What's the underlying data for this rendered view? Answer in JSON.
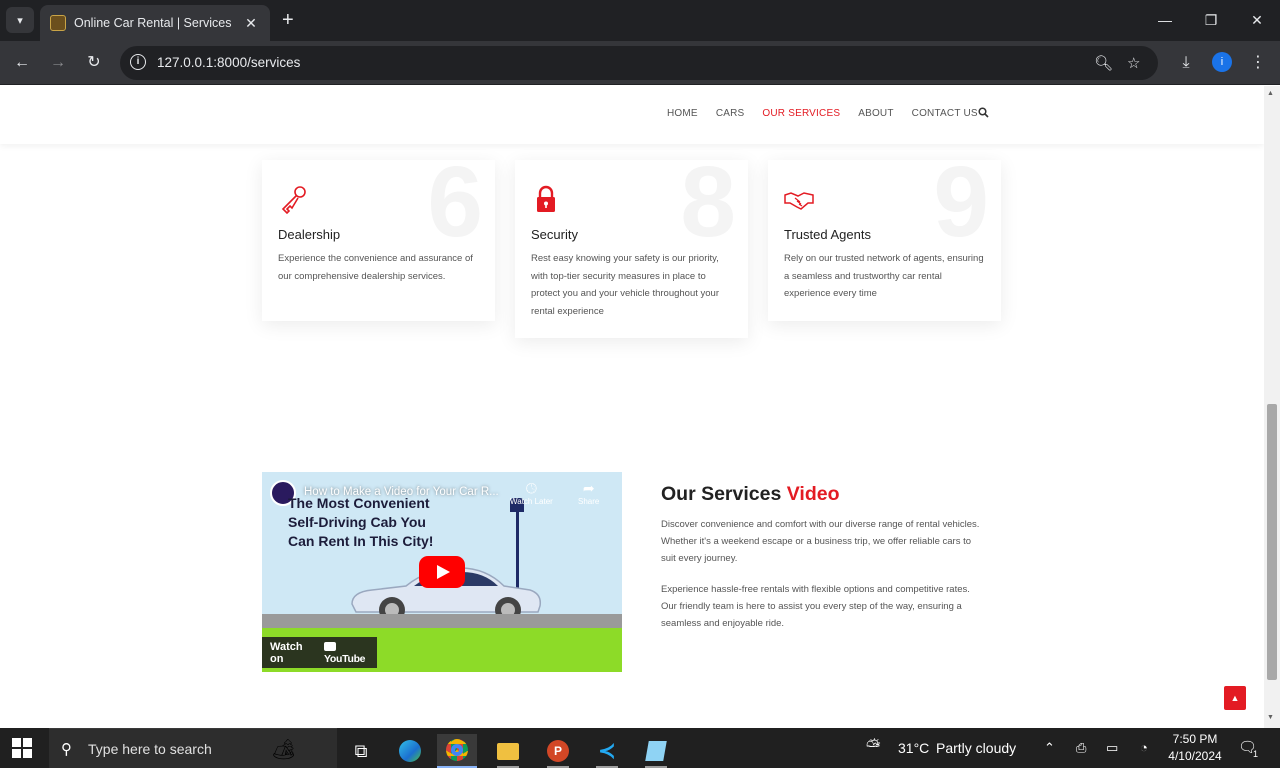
{
  "browser": {
    "tab_title": "Online Car Rental | Services",
    "url": "127.0.0.1:8000/services",
    "profile_initial": "i"
  },
  "site": {
    "nav": [
      "HOME",
      "CARS",
      "OUR SERVICES",
      "ABOUT",
      "CONTACT US"
    ],
    "active_nav": "OUR SERVICES"
  },
  "services": [
    {
      "number": "6",
      "title": "Dealership",
      "text": "Experience the convenience and assurance of our comprehensive dealership services.",
      "icon": "key-icon"
    },
    {
      "number": "8",
      "title": "Security",
      "text": "Rest easy knowing your safety is our priority, with top-tier security measures in place to protect you and your vehicle throughout your rental experience",
      "icon": "lock-icon"
    },
    {
      "number": "9",
      "title": "Trusted Agents",
      "text": "Rely on our trusted network of agents, ensuring a seamless and trustworthy car rental experience every time",
      "icon": "handshake-icon"
    }
  ],
  "video": {
    "yt_title": "How to Make a Video for Your Car R...",
    "headline_line1": "The Most Convenient",
    "headline_line2": "Self-Driving Cab You",
    "headline_line3": "Can Rent In This City!",
    "watch_later": "Watch Later",
    "share": "Share",
    "watch_on": "Watch on",
    "youtube": "YouTube"
  },
  "services_video": {
    "title_part1": "Our Services",
    "title_part2": "Video",
    "para1": "Discover convenience and comfort with our diverse range of rental vehicles. Whether it's a weekend escape or a business trip, we offer reliable cars to suit every journey.",
    "para2": "Experience hassle-free rentals with flexible options and competitive rates. Our friendly team is here to assist you every step of the way, ensuring a seamless and enjoyable ride."
  },
  "taskbar": {
    "search_placeholder": "Type here to search",
    "weather_temp": "31°C",
    "weather_desc": "Partly cloudy",
    "time": "7:50 PM",
    "date": "4/10/2024",
    "notification_count": "1"
  },
  "colors": {
    "accent_red": "#e31b23",
    "chrome_dark": "#202124",
    "chrome_toolbar": "#35363a"
  }
}
